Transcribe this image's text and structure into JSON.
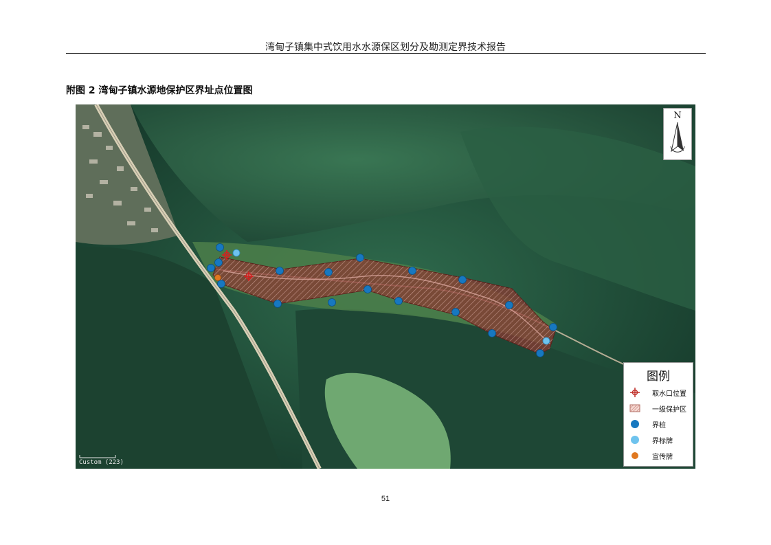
{
  "header": {
    "title": "湾甸子镇集中式饮用水水源保区划分及勘测定界技术报告"
  },
  "figure": {
    "caption": "附图 2  湾甸子镇水源地保护区界址点位置图"
  },
  "map": {
    "north_label": "N",
    "scale_text": "Custom (223)",
    "legend": {
      "title": "图例",
      "items": [
        {
          "label": "取水口位置",
          "symbol": "intake-cross-icon",
          "color": "#c0302a"
        },
        {
          "label": "一级保护区",
          "symbol": "hatched-zone-icon",
          "color": "#e8a9a0"
        },
        {
          "label": "界桩",
          "symbol": "boundary-pile-icon",
          "color": "#1778c0"
        },
        {
          "label": "界标牌",
          "symbol": "boundary-sign-icon",
          "color": "#6ec3ee"
        },
        {
          "label": "宣传牌",
          "symbol": "promo-sign-icon",
          "color": "#e07820"
        }
      ]
    },
    "colors": {
      "protection_zone": "#8a3a32",
      "boundary_pile": "#1778c0",
      "boundary_sign": "#6ec3ee",
      "promo_sign": "#e07820",
      "intake": "#d42020"
    }
  },
  "page": {
    "number": "51"
  }
}
